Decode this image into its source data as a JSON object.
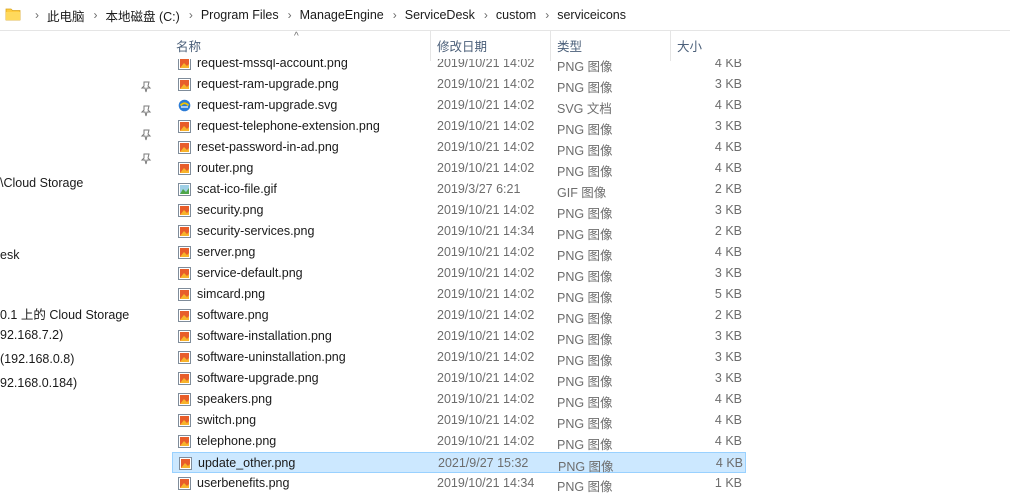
{
  "breadcrumb": [
    "此电脑",
    "本地磁盘 (C:)",
    "Program Files",
    "ManageEngine",
    "ServiceDesk",
    "custom",
    "serviceicons"
  ],
  "nav": {
    "items": [
      "\\Cloud Storage",
      "esk",
      "0.1 上的 Cloud Storage",
      "92.168.7.2)",
      "(192.168.0.8)",
      "92.168.0.184)"
    ]
  },
  "columns": {
    "name": "名称",
    "date": "修改日期",
    "type": "类型",
    "size": "大小"
  },
  "files": [
    {
      "name": "request-mssql-account.png",
      "date": "2019/10/21 14:02",
      "type": "PNG 图像",
      "size": "4 KB",
      "icon": "png-image-icon"
    },
    {
      "name": "request-ram-upgrade.png",
      "date": "2019/10/21 14:02",
      "type": "PNG 图像",
      "size": "3 KB",
      "icon": "png-image-icon"
    },
    {
      "name": "request-ram-upgrade.svg",
      "date": "2019/10/21 14:02",
      "type": "SVG 文档",
      "size": "4 KB",
      "icon": "svg-document-icon"
    },
    {
      "name": "request-telephone-extension.png",
      "date": "2019/10/21 14:02",
      "type": "PNG 图像",
      "size": "3 KB",
      "icon": "png-image-icon"
    },
    {
      "name": "reset-password-in-ad.png",
      "date": "2019/10/21 14:02",
      "type": "PNG 图像",
      "size": "4 KB",
      "icon": "png-image-icon"
    },
    {
      "name": "router.png",
      "date": "2019/10/21 14:02",
      "type": "PNG 图像",
      "size": "4 KB",
      "icon": "png-image-icon"
    },
    {
      "name": "scat-ico-file.gif",
      "date": "2019/3/27 6:21",
      "type": "GIF 图像",
      "size": "2 KB",
      "icon": "gif-image-icon"
    },
    {
      "name": "security.png",
      "date": "2019/10/21 14:02",
      "type": "PNG 图像",
      "size": "3 KB",
      "icon": "png-image-icon"
    },
    {
      "name": "security-services.png",
      "date": "2019/10/21 14:34",
      "type": "PNG 图像",
      "size": "2 KB",
      "icon": "png-image-icon"
    },
    {
      "name": "server.png",
      "date": "2019/10/21 14:02",
      "type": "PNG 图像",
      "size": "4 KB",
      "icon": "png-image-icon"
    },
    {
      "name": "service-default.png",
      "date": "2019/10/21 14:02",
      "type": "PNG 图像",
      "size": "3 KB",
      "icon": "png-image-icon"
    },
    {
      "name": "simcard.png",
      "date": "2019/10/21 14:02",
      "type": "PNG 图像",
      "size": "5 KB",
      "icon": "png-image-icon"
    },
    {
      "name": "software.png",
      "date": "2019/10/21 14:02",
      "type": "PNG 图像",
      "size": "2 KB",
      "icon": "png-image-icon"
    },
    {
      "name": "software-installation.png",
      "date": "2019/10/21 14:02",
      "type": "PNG 图像",
      "size": "3 KB",
      "icon": "png-image-icon"
    },
    {
      "name": "software-uninstallation.png",
      "date": "2019/10/21 14:02",
      "type": "PNG 图像",
      "size": "3 KB",
      "icon": "png-image-icon"
    },
    {
      "name": "software-upgrade.png",
      "date": "2019/10/21 14:02",
      "type": "PNG 图像",
      "size": "3 KB",
      "icon": "png-image-icon"
    },
    {
      "name": "speakers.png",
      "date": "2019/10/21 14:02",
      "type": "PNG 图像",
      "size": "4 KB",
      "icon": "png-image-icon"
    },
    {
      "name": "switch.png",
      "date": "2019/10/21 14:02",
      "type": "PNG 图像",
      "size": "4 KB",
      "icon": "png-image-icon"
    },
    {
      "name": "telephone.png",
      "date": "2019/10/21 14:02",
      "type": "PNG 图像",
      "size": "4 KB",
      "icon": "png-image-icon"
    },
    {
      "name": "update_other.png",
      "date": "2021/9/27 15:32",
      "type": "PNG 图像",
      "size": "4 KB",
      "icon": "png-image-icon",
      "selected": true
    },
    {
      "name": "userbenefits.png",
      "date": "2019/10/21 14:34",
      "type": "PNG 图像",
      "size": "1 KB",
      "icon": "png-image-icon"
    }
  ],
  "colors": {
    "selection_bg": "#cce8ff",
    "selection_border": "#99d1ff",
    "header_text": "#4c607a",
    "folder": "#ffcb3d"
  }
}
